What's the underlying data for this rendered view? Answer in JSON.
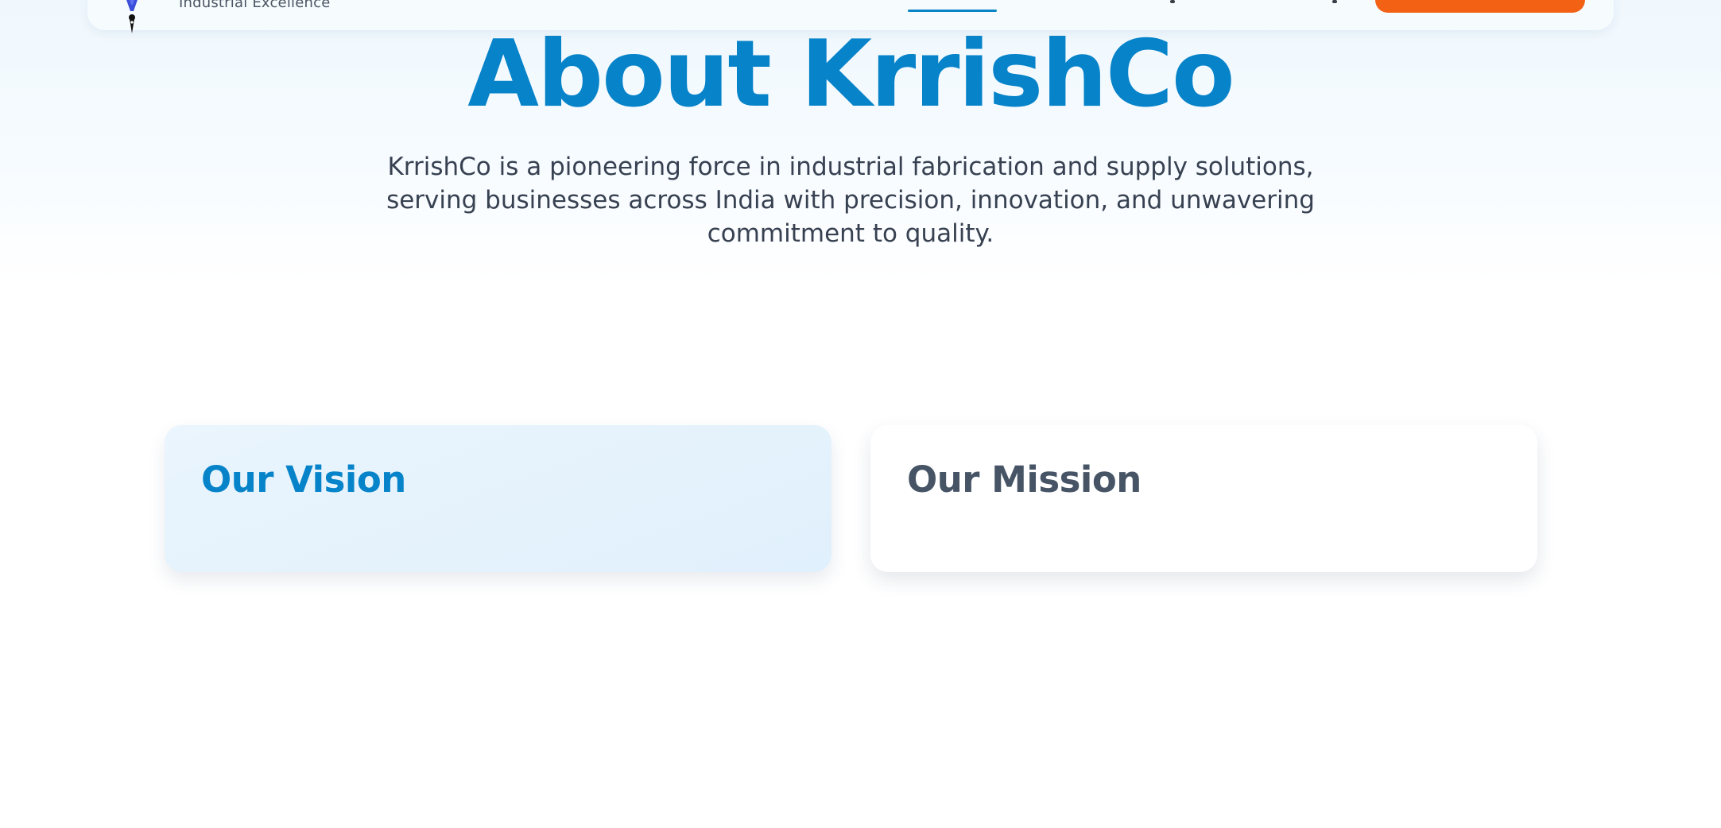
{
  "header": {
    "logo_tagline": "Industrial Excellence",
    "cta_color": "#f26114",
    "accent_color": "#0a84c6"
  },
  "hero": {
    "title": "About KrrishCo",
    "description": "KrrishCo is a pioneering force in industrial fabrication and supply solutions, serving businesses across India with precision, innovation, and unwavering commitment to quality."
  },
  "cards": {
    "vision": {
      "title": "Our Vision"
    },
    "mission": {
      "title": "Our Mission"
    }
  }
}
